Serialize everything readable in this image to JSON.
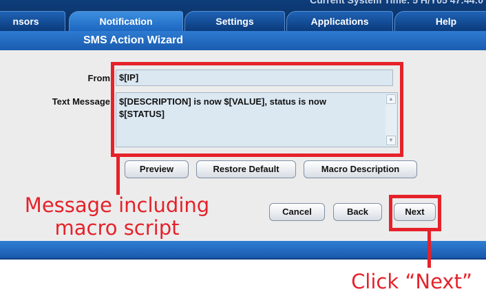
{
  "header": {
    "system_time": "Current System Time: 5 H/Y05 47:44:0",
    "tabs": [
      {
        "label": "nsors",
        "active": false
      },
      {
        "label": "Notification",
        "active": true
      },
      {
        "label": "Settings",
        "active": false
      },
      {
        "label": "Applications",
        "active": false
      },
      {
        "label": "Help",
        "active": false
      }
    ]
  },
  "wizard": {
    "title": "SMS Action Wizard",
    "from_label": "From",
    "from_value": "$[IP]",
    "message_label": "Text Message",
    "message_value": "$[DESCRIPTION] is now $[VALUE], status is now $[STATUS]",
    "buttons": {
      "preview": "Preview",
      "restore_default": "Restore Default",
      "macro_description": "Macro Description",
      "cancel": "Cancel",
      "back": "Back",
      "next": "Next"
    }
  },
  "annotations": {
    "message_note_line1": "Message including",
    "message_note_line2": "macro script",
    "next_note": "Click “Next”",
    "color": "#e5222a"
  },
  "colors": {
    "tabbar": "#0e3d7a",
    "title_band": "#2d7bd2",
    "content_bg": "#ececec",
    "field_bg": "#dbe8f2"
  }
}
